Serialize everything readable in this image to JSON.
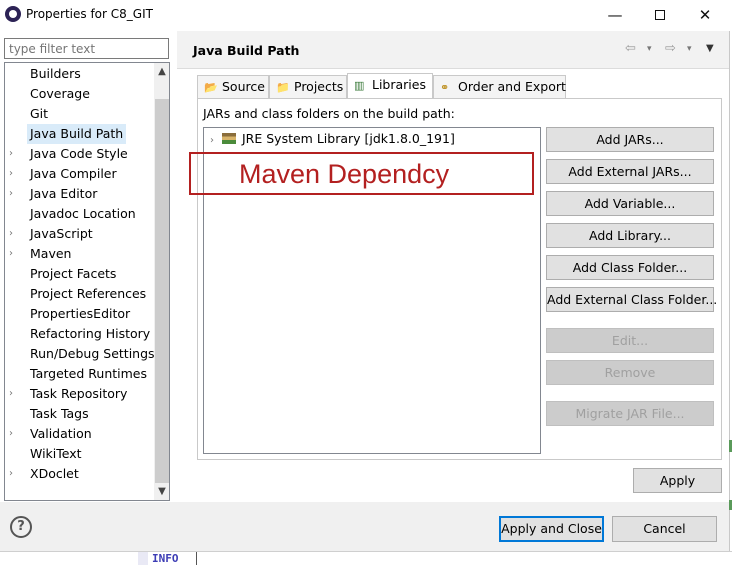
{
  "window": {
    "title": "Properties for C8_GIT",
    "minimize_glyph": "—",
    "close_glyph": "✕"
  },
  "filter": {
    "placeholder": "type filter text",
    "value": ""
  },
  "tree": {
    "items": [
      {
        "label": "Builders",
        "expandable": false
      },
      {
        "label": "Coverage",
        "expandable": false
      },
      {
        "label": "Git",
        "expandable": false
      },
      {
        "label": "Java Build Path",
        "expandable": false,
        "selected": true
      },
      {
        "label": "Java Code Style",
        "expandable": true
      },
      {
        "label": "Java Compiler",
        "expandable": true
      },
      {
        "label": "Java Editor",
        "expandable": true
      },
      {
        "label": "Javadoc Location",
        "expandable": false
      },
      {
        "label": "JavaScript",
        "expandable": true
      },
      {
        "label": "Maven",
        "expandable": true
      },
      {
        "label": "Project Facets",
        "expandable": false
      },
      {
        "label": "Project References",
        "expandable": false
      },
      {
        "label": "PropertiesEditor",
        "expandable": false
      },
      {
        "label": "Refactoring History",
        "expandable": false
      },
      {
        "label": "Run/Debug Settings",
        "expandable": false
      },
      {
        "label": "Targeted Runtimes",
        "expandable": false
      },
      {
        "label": "Task Repository",
        "expandable": true
      },
      {
        "label": "Task Tags",
        "expandable": false
      },
      {
        "label": "Validation",
        "expandable": true
      },
      {
        "label": "WikiText",
        "expandable": false
      },
      {
        "label": "XDoclet",
        "expandable": true
      }
    ],
    "expander_glyph": "›"
  },
  "page": {
    "title": "Java Build Path",
    "nav_back_glyph": "⇦",
    "nav_forward_glyph": "⇨",
    "dropdown_glyph": "▾",
    "menu_glyph": "▼"
  },
  "tabs": [
    {
      "label": "Source",
      "icon": "source-folder-icon",
      "active": false
    },
    {
      "label": "Projects",
      "icon": "projects-folder-icon",
      "active": false
    },
    {
      "label": "Libraries",
      "icon": "libraries-icon",
      "active": true
    },
    {
      "label": "Order and Export",
      "icon": "order-export-icon",
      "active": false
    }
  ],
  "libraries": {
    "label": "JARs and class folders on the build path:",
    "entries": [
      {
        "label": "JRE System Library [jdk1.8.0_191]",
        "icon": "jar-library-icon"
      }
    ]
  },
  "annotation": {
    "text": "Maven Dependcy",
    "color": "#b32020"
  },
  "buttons": [
    {
      "label": "Add JARs...",
      "enabled": true
    },
    {
      "label": "Add External JARs...",
      "enabled": true
    },
    {
      "label": "Add Variable...",
      "enabled": true
    },
    {
      "label": "Add Library...",
      "enabled": true
    },
    {
      "label": "Add Class Folder...",
      "enabled": true
    },
    {
      "label": "Add External Class Folder...",
      "enabled": true
    },
    {
      "label": "Edit...",
      "enabled": false
    },
    {
      "label": "Remove",
      "enabled": false
    },
    {
      "label": "Migrate JAR File...",
      "enabled": false
    }
  ],
  "apply_label": "Apply",
  "footer": {
    "help_glyph": "?",
    "apply_close_label": "Apply and Close",
    "cancel_label": "Cancel"
  },
  "background": {
    "text": "INFO"
  },
  "colors": {
    "accent": "#0078d7",
    "selection": "#d9ebf9",
    "annotation": "#b32020"
  }
}
